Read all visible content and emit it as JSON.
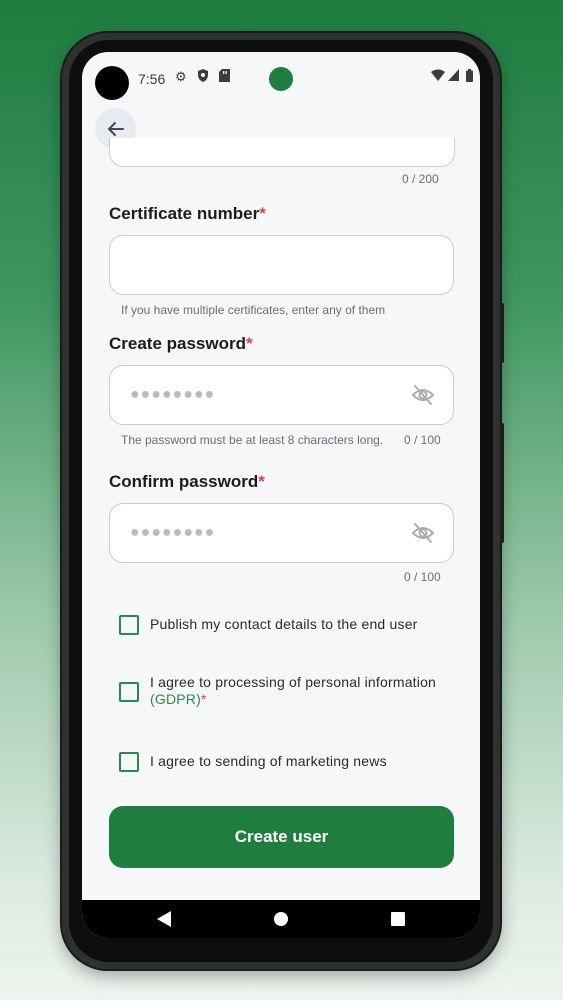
{
  "status_bar": {
    "time": "7:56",
    "icons": [
      "settings-icon",
      "shield-icon",
      "sd-card-icon",
      "wifi-icon",
      "signal-icon",
      "battery-icon"
    ]
  },
  "header": {
    "back_icon": "arrow-left-icon"
  },
  "previous_field": {
    "counter": "0 / 200"
  },
  "certificate": {
    "label": "Certificate number",
    "required": "*",
    "value": "",
    "helper": "If you have multiple certificates, enter any of them"
  },
  "password": {
    "label": "Create password",
    "required": "*",
    "masked_value": "●●●●●●●●",
    "helper": "The password must be at least 8 characters long.",
    "counter": "0 / 100",
    "toggle_icon": "eye-off-icon"
  },
  "confirm_password": {
    "label": "Confirm password",
    "required": "*",
    "masked_value": "●●●●●●●●",
    "counter": "0 / 100",
    "toggle_icon": "eye-off-icon"
  },
  "checkboxes": {
    "publish": {
      "label": "Publish my contact details to the end user",
      "checked": false
    },
    "gdpr": {
      "label": "I agree to processing of personal information",
      "link": "(GDPR)",
      "required": "*",
      "checked": false
    },
    "marketing": {
      "label": "I agree to sending of marketing news",
      "checked": false
    }
  },
  "submit": {
    "label": "Create user"
  },
  "nav": {
    "back_icon": "triangle-back-icon",
    "home_icon": "circle-home-icon",
    "recents_icon": "square-recents-icon"
  },
  "colors": {
    "accent": "#1e7d3f",
    "required": "#d64545",
    "background": "#f6f7f9"
  }
}
